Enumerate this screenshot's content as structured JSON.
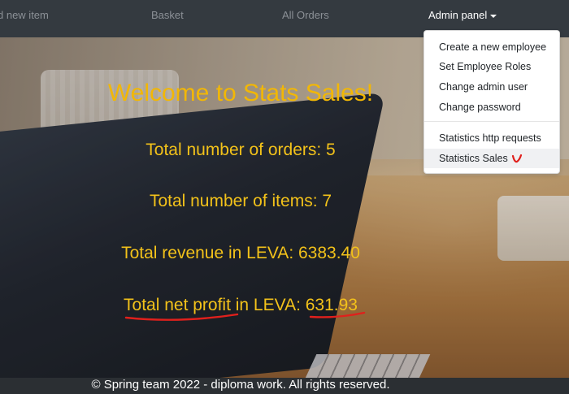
{
  "navbar": {
    "links": [
      {
        "label": "d new item"
      },
      {
        "label": "Basket"
      },
      {
        "label": "All Orders"
      },
      {
        "label": "Admin panel"
      }
    ]
  },
  "admin_dropdown": {
    "items": [
      {
        "label": "Create a new employee"
      },
      {
        "label": "Set Employee Roles"
      },
      {
        "label": "Change admin user"
      },
      {
        "label": "Change password"
      },
      {
        "label": "Statistics http requests"
      },
      {
        "label": "Statistics Sales"
      }
    ]
  },
  "main": {
    "title": "Welcome to Stats Sales!",
    "stats": [
      {
        "text": "Total number of orders: 5"
      },
      {
        "text": "Total number of items: 7"
      },
      {
        "text": "Total revenue in LEVA: 6383.40"
      },
      {
        "text": "Total net profit in LEVA: 631.93"
      }
    ]
  },
  "footer": {
    "text": "© Spring team 2022 - diploma work. All rights reserved."
  },
  "colors": {
    "navbar_bg": "#343a40",
    "stat_text": "#f3c21a",
    "annotation": "#e0201c"
  }
}
